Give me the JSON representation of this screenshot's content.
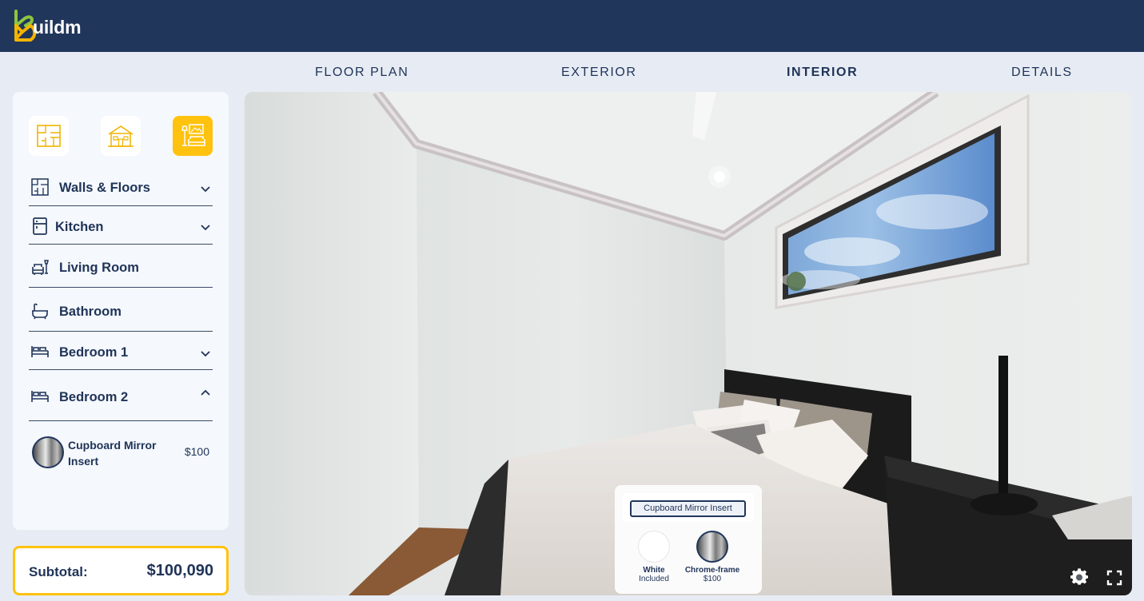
{
  "brand": {
    "logo_text": "uildm",
    "accent_color": "#ffc20e",
    "nav_color": "#21365b"
  },
  "tabs": [
    {
      "label": "FLOOR PLAN",
      "active": false
    },
    {
      "label": "EXTERIOR",
      "active": false
    },
    {
      "label": "INTERIOR",
      "active": true
    },
    {
      "label": "DETAILS",
      "active": false
    }
  ],
  "category_buttons": [
    {
      "icon": "floor-plan-icon",
      "active": false
    },
    {
      "icon": "house-exterior-icon",
      "active": false
    },
    {
      "icon": "living-room-interior-icon",
      "active": true
    }
  ],
  "sidebar": {
    "sections": [
      {
        "label": "Walls & Floors",
        "icon": "floor-plan-icon",
        "chevron": "down"
      },
      {
        "label": "Kitchen",
        "icon": "fridge-icon",
        "chevron": "down"
      },
      {
        "label": "Living Room",
        "icon": "armchair-lamp-icon",
        "chevron": ""
      },
      {
        "label": "Bathroom",
        "icon": "bathtub-icon",
        "chevron": ""
      },
      {
        "label": "Bedroom 1",
        "icon": "bed-icon",
        "chevron": "down"
      },
      {
        "label": "Bedroom 2",
        "icon": "bed-icon",
        "chevron": "up"
      }
    ],
    "selected_item": {
      "name": "Cupboard Mirror Insert",
      "price": "$100",
      "swatch": "chrome-frame"
    }
  },
  "subtotal": {
    "label": "Subtotal:",
    "value": "$100,090"
  },
  "viewer": {
    "popup": {
      "title": "Cupboard Mirror Insert",
      "options": [
        {
          "name": "White",
          "price": "Included",
          "swatch": "white"
        },
        {
          "name": "Chrome-frame",
          "price": "$100",
          "swatch": "chrome"
        }
      ]
    },
    "controls": [
      "settings-gear-icon",
      "fullscreen-icon"
    ]
  }
}
